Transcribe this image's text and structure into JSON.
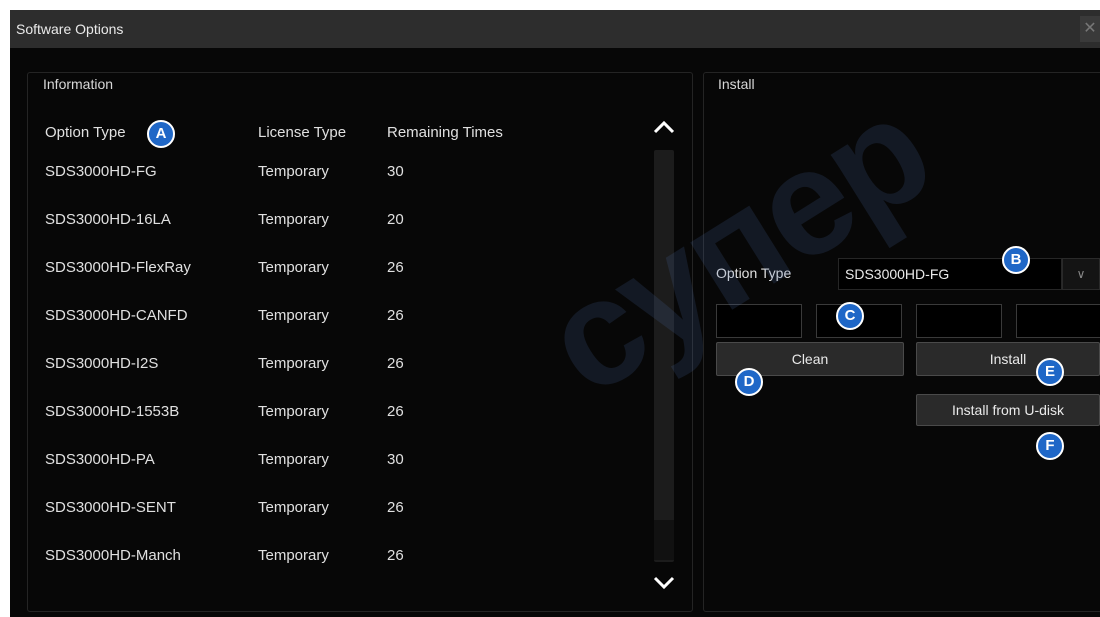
{
  "window": {
    "title": "Software Options",
    "close_glyph": "✕"
  },
  "information": {
    "label": "Information",
    "columns": [
      "Option Type",
      "License Type",
      "Remaining Times"
    ],
    "rows": [
      [
        "SDS3000HD-FG",
        "Temporary",
        "30"
      ],
      [
        "SDS3000HD-16LA",
        "Temporary",
        "20"
      ],
      [
        "SDS3000HD-FlexRay",
        "Temporary",
        "26"
      ],
      [
        "SDS3000HD-CANFD",
        "Temporary",
        "26"
      ],
      [
        "SDS3000HD-I2S",
        "Temporary",
        "26"
      ],
      [
        "SDS3000HD-1553B",
        "Temporary",
        "26"
      ],
      [
        "SDS3000HD-PA",
        "Temporary",
        "30"
      ],
      [
        "SDS3000HD-SENT",
        "Temporary",
        "26"
      ],
      [
        "SDS3000HD-Manch",
        "Temporary",
        "26"
      ]
    ]
  },
  "install": {
    "label": "Install",
    "option_type_label": "Option Type",
    "option_type_value": "SDS3000HD-FG",
    "dropdown_glyph": "∨",
    "clean_label": "Clean",
    "install_label": "Install",
    "install_udisk_label": "Install from U-disk"
  },
  "markers": {
    "a": "A",
    "b": "B",
    "c": "C",
    "d": "D",
    "e": "E",
    "f": "F"
  },
  "watermark": {
    "text": "супер"
  },
  "colors": {
    "marker": "#1f67c7",
    "background": "#070707",
    "titlebar": "#2d2d2d"
  }
}
